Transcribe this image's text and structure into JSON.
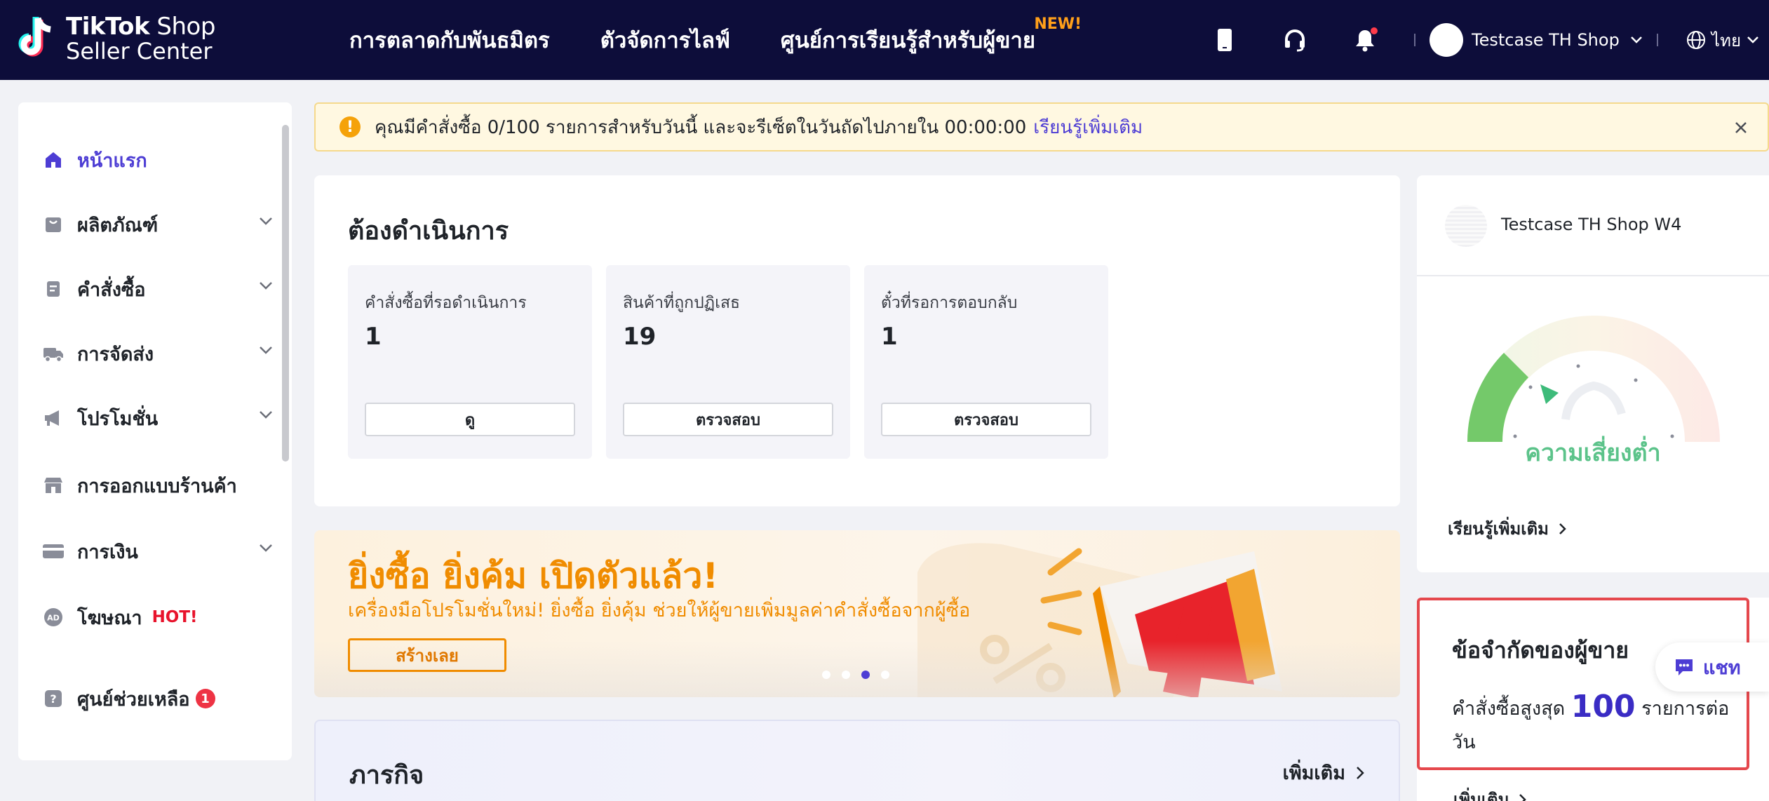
{
  "header": {
    "logo_line1_bold": "TikTok",
    "logo_line1_rest": " Shop",
    "logo_line2": "Seller Center",
    "nav": [
      {
        "label": "การตลาดกับพันธมิตร"
      },
      {
        "label": "ตัวจัดการไลฟ์"
      },
      {
        "label": "ศูนย์การเรียนรู้สำหรับผู้ขาย",
        "badge": "NEW!"
      }
    ],
    "account_name": "Testcase TH Shop W4",
    "language": "ไทย"
  },
  "sidebar": {
    "items": [
      {
        "label": "หน้าแรก",
        "icon": "home-icon"
      },
      {
        "label": "ผลิตภัณฑ์",
        "icon": "product-icon"
      },
      {
        "label": "คำสั่งซื้อ",
        "icon": "order-icon"
      },
      {
        "label": "การจัดส่ง",
        "icon": "truck-icon"
      },
      {
        "label": "โปรโมชั่น",
        "icon": "megaphone-icon"
      },
      {
        "label": "การออกแบบร้านค้า",
        "icon": "shop-icon"
      },
      {
        "label": "การเงิน",
        "icon": "card-icon"
      },
      {
        "label": "โฆษณา",
        "icon": "ad-icon",
        "badge": "HOT!"
      },
      {
        "label": "ศูนย์ช่วยเหลือ",
        "icon": "help-icon",
        "count": "1"
      }
    ]
  },
  "notice": {
    "text": "คุณมีคำสั่งซื้อ 0/100 รายการสำหรับวันนี้ และจะรีเซ็ตในวันถัดไปภายใน 00:00:00",
    "link": "เรียนรู้เพิ่มเติม"
  },
  "todo": {
    "title": "ต้องดำเนินการ",
    "boxes": [
      {
        "label": "คำสั่งซื้อที่รอดำเนินการ",
        "value": "1",
        "button": "ดู"
      },
      {
        "label": "สินค้าที่ถูกปฏิเสธ",
        "value": "19",
        "button": "ตรวจสอบ"
      },
      {
        "label": "ตั๋วที่รอการตอบกลับ",
        "value": "1",
        "button": "ตรวจสอบ"
      }
    ]
  },
  "banner": {
    "title": "ยิ่งซื้อ ยิ่งค้ม เปิดตัวแล้ว!",
    "subtitle": "เครื่องมือโปรโมชั่นใหม่! ยิ่งซื้อ ยิ่งคุ้ม ช่วยให้ผู้ขายเพิ่มมูลค่าคำสั่งซื้อจากผู้ซื้อ",
    "button": "สร้างเลย",
    "active_slide": 3,
    "slides": 4
  },
  "tasks": {
    "title": "ภารกิจ",
    "more": "เพิ่มเติม"
  },
  "shop": {
    "name": "Testcase TH Shop W4",
    "risk": "ความเสี่ยงต่ำ",
    "learn_more": "เรียนรู้เพิ่มเติม"
  },
  "limits": {
    "title": "ข้อจำกัดของผู้ขาย",
    "prefix": "คำสั่งซื้อสูงสุด",
    "value": "100",
    "suffix": "รายการต่อวัน",
    "more": "เพิ่มเติม"
  },
  "chat": {
    "label": "แชท"
  },
  "colors": {
    "header_bg": "#0d0d3a",
    "accent": "#4d3dd4",
    "banner_orange": "#f08c00",
    "risk_green": "#5cc38a",
    "highlight_red": "#e5484d"
  }
}
